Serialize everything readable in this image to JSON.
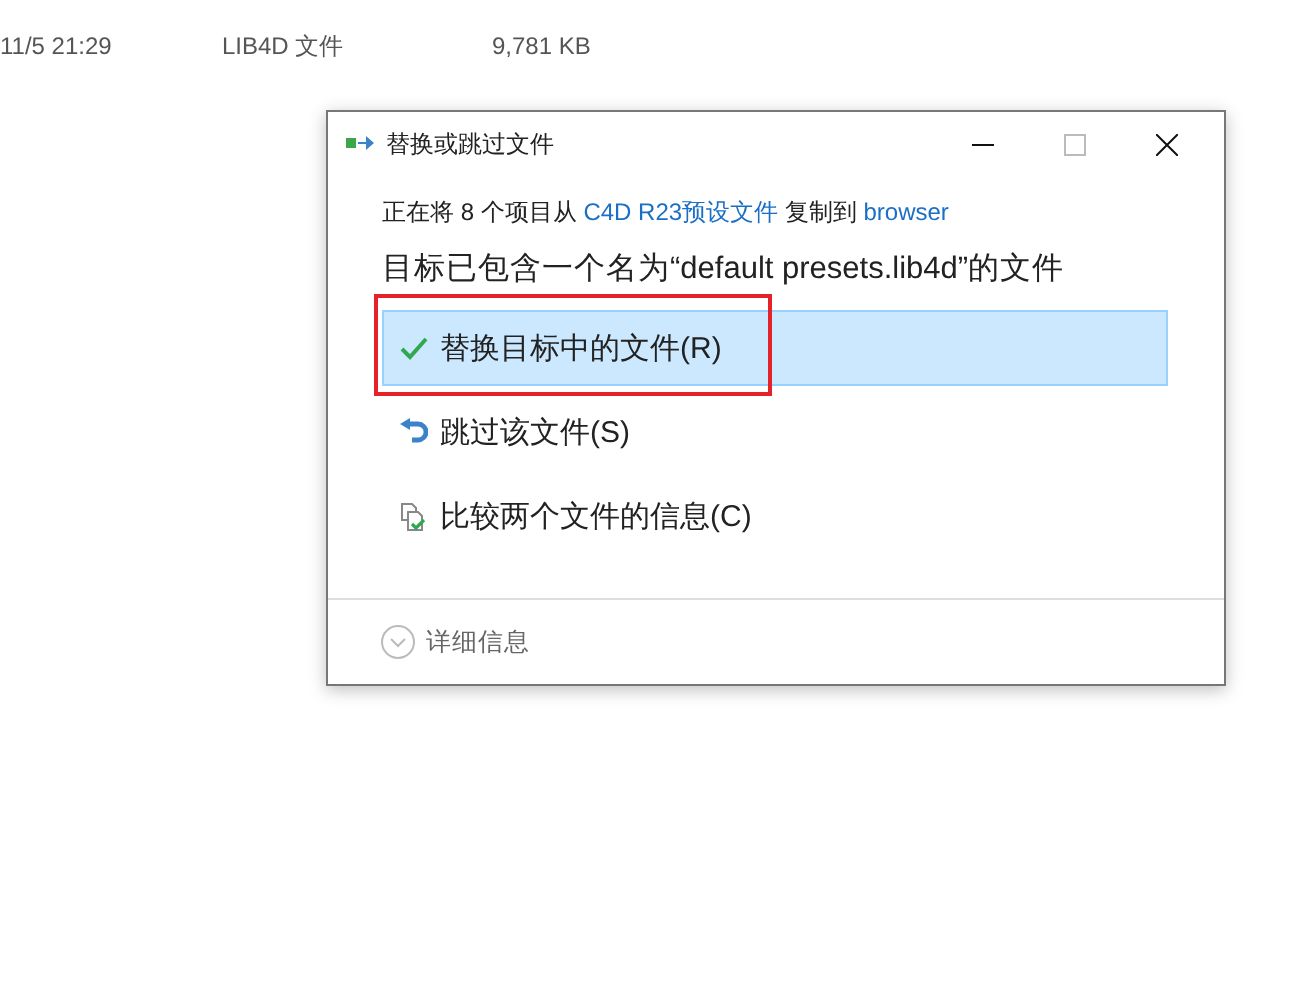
{
  "file_row": {
    "modified": "11/5 21:29",
    "type": "LIB4D 文件",
    "size": "9,781 KB"
  },
  "dialog": {
    "title": "替换或跳过文件",
    "copy_message": {
      "prefix": "正在将 8 个项目从",
      "source": "C4D R23预设文件",
      "middle": "复制到",
      "destination": "browser"
    },
    "heading": "目标已包含一个名为“default presets.lib4d”的文件",
    "options": [
      {
        "kind": "replace",
        "label": "替换目标中的文件(R)",
        "selected": true,
        "annotated": true
      },
      {
        "kind": "skip",
        "label": "跳过该文件(S)",
        "selected": false,
        "annotated": false
      },
      {
        "kind": "compare",
        "label": "比较两个文件的信息(C)",
        "selected": false,
        "annotated": false
      }
    ],
    "details": {
      "label": "详细信息",
      "expanded": false
    }
  }
}
